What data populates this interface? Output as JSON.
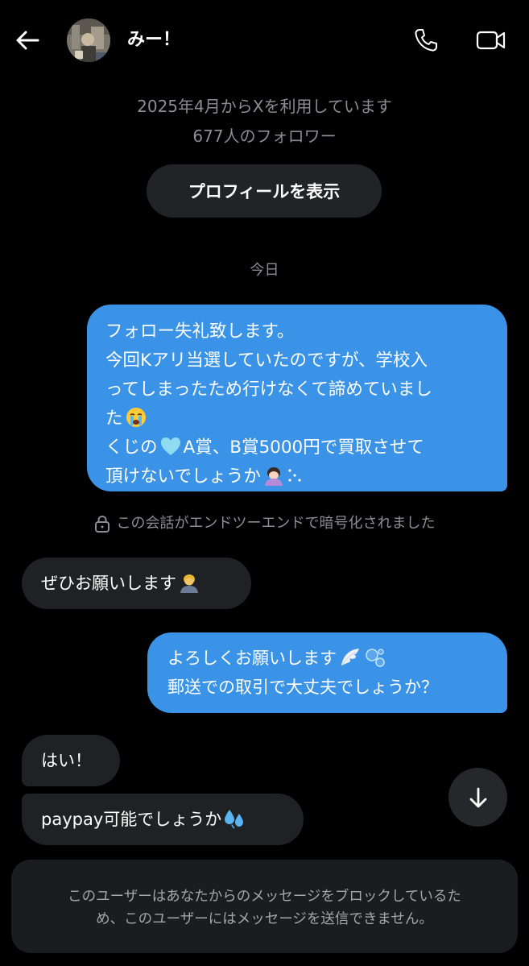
{
  "header": {
    "contact_name": "みー！"
  },
  "profile": {
    "joined": "2025年4月からXを利用しています",
    "followers": "677人のフォロワー",
    "view_profile_label": "プロフィールを表示"
  },
  "date_divider": "今日",
  "encryption_note": "この会話がエンドツーエンドで暗号化されました",
  "messages": [
    {
      "direction": "sent",
      "lines": [
        "フォロー失礼致します。",
        "今回Kアリ当選していたのですが、学校入",
        "ってしまったため行けなくて諦めていまし",
        "た",
        "くじの",
        "A賞、B賞5000円で買取させて",
        "頂けないでしょうか"
      ],
      "emojis": [
        "loudly-crying-face-emoji",
        "light-blue-heart-emoji",
        "person-bowing-emoji",
        "sparkle-dots"
      ]
    },
    {
      "direction": "received",
      "lines": [
        "ぜひお願いします"
      ],
      "emojis": [
        "person-bowing-emoji"
      ]
    },
    {
      "direction": "sent",
      "lines": [
        "よろしくお願いします",
        "郵送での取引で大丈夫でしょうか？"
      ],
      "emojis": [
        "wing-emoji",
        "bubbles-emoji"
      ]
    },
    {
      "direction": "received",
      "lines": [
        "はい！"
      ]
    },
    {
      "direction": "received",
      "lines": [
        "paypay可能でしょうか"
      ],
      "emojis": [
        "sweat-droplets-emoji"
      ]
    }
  ],
  "blocked_notice": {
    "line1": "このユーザーはあなたからのメッセージをブロックしているた",
    "line2": "め、このユーザーにはメッセージを送信できません。"
  },
  "colors": {
    "background": "#000000",
    "sent_bubble": "#3a93e6",
    "received_bubble": "#202124",
    "muted_text": "#8a8d91"
  }
}
